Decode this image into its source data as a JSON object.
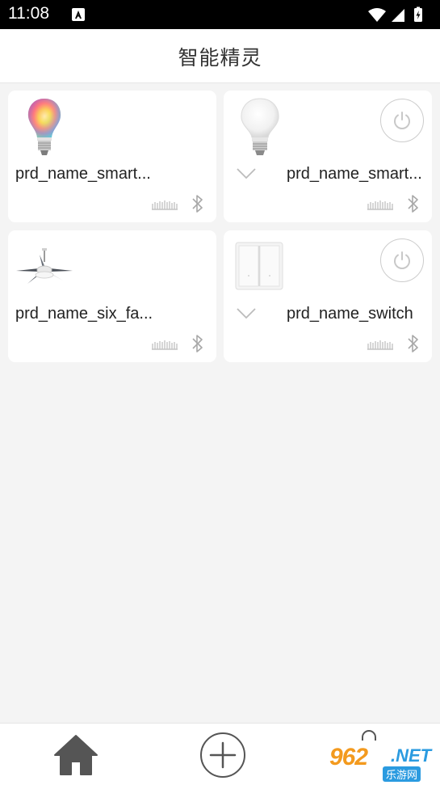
{
  "status_bar": {
    "time": "11:08"
  },
  "header": {
    "title": "智能精灵"
  },
  "devices": [
    {
      "name": "prd_name_smart...",
      "image": "rgb-bulb-image",
      "has_power": false
    },
    {
      "name": "prd_name_smart...",
      "image": "white-bulb-image",
      "has_power": true
    },
    {
      "name": "prd_name_six_fa...",
      "image": "ceiling-fan-image",
      "has_power": false
    },
    {
      "name": "prd_name_switch",
      "image": "wall-switch-image",
      "has_power": true
    }
  ],
  "watermark": {
    "number": "962",
    "domain": ".NET",
    "sub": "乐游网"
  },
  "colors": {
    "background": "#f4f4f4",
    "card": "#ffffff",
    "icon_gray": "#b5b5b5",
    "nav_dark": "#555555"
  }
}
